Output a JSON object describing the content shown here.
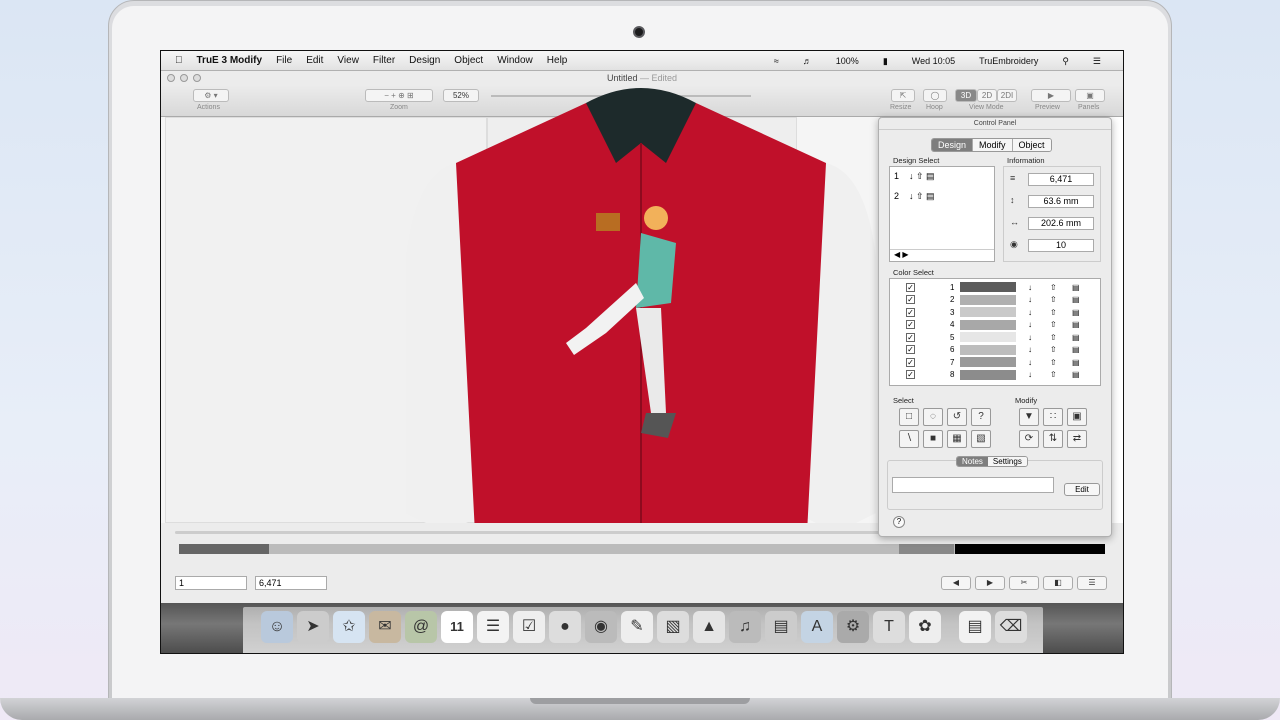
{
  "menubar": {
    "app_name": "TruE 3 Modify",
    "menus": [
      "File",
      "Edit",
      "View",
      "Filter",
      "Design",
      "Object",
      "Window",
      "Help"
    ],
    "battery": "100%",
    "clock": "Wed 10:05",
    "user": "TruEmbroidery"
  },
  "window": {
    "title": "Untitled",
    "edited": "— Edited"
  },
  "toolbar": {
    "actions_label": "Actions",
    "zoom_label": "Zoom",
    "zoom_value": "52%",
    "resize_label": "Resize",
    "hoop_label": "Hoop",
    "view_mode_label": "View Mode",
    "view_3d": "3D",
    "view_2d": "2D",
    "view_2di": "2DI",
    "preview_label": "Preview",
    "panels_label": "Panels"
  },
  "control_panel": {
    "title": "Control Panel",
    "tabs": [
      "Design",
      "Modify",
      "Object"
    ],
    "active_tab": "Design",
    "design_select_label": "Design Select",
    "designs": [
      "1",
      "2"
    ],
    "information_label": "Information",
    "stitches": "6,471",
    "height": "63.6 mm",
    "width": "202.6 mm",
    "colors": "10",
    "color_select_label": "Color Select",
    "colors_list": [
      {
        "num": "1",
        "color": "#5c5c5c"
      },
      {
        "num": "2",
        "color": "#b0b0b0"
      },
      {
        "num": "3",
        "color": "#c9c9c9"
      },
      {
        "num": "4",
        "color": "#a8a8a8"
      },
      {
        "num": "5",
        "color": "#e6e6e6"
      },
      {
        "num": "6",
        "color": "#bdbdbd"
      },
      {
        "num": "7",
        "color": "#9a9a9a"
      },
      {
        "num": "8",
        "color": "#8c8c8c"
      }
    ],
    "select_label": "Select",
    "modify_label": "Modify",
    "notes_tab": "Notes",
    "settings_tab": "Settings",
    "edit_button": "Edit",
    "help": "?"
  },
  "bottom": {
    "start_field": "1",
    "end_field": "6,471"
  }
}
